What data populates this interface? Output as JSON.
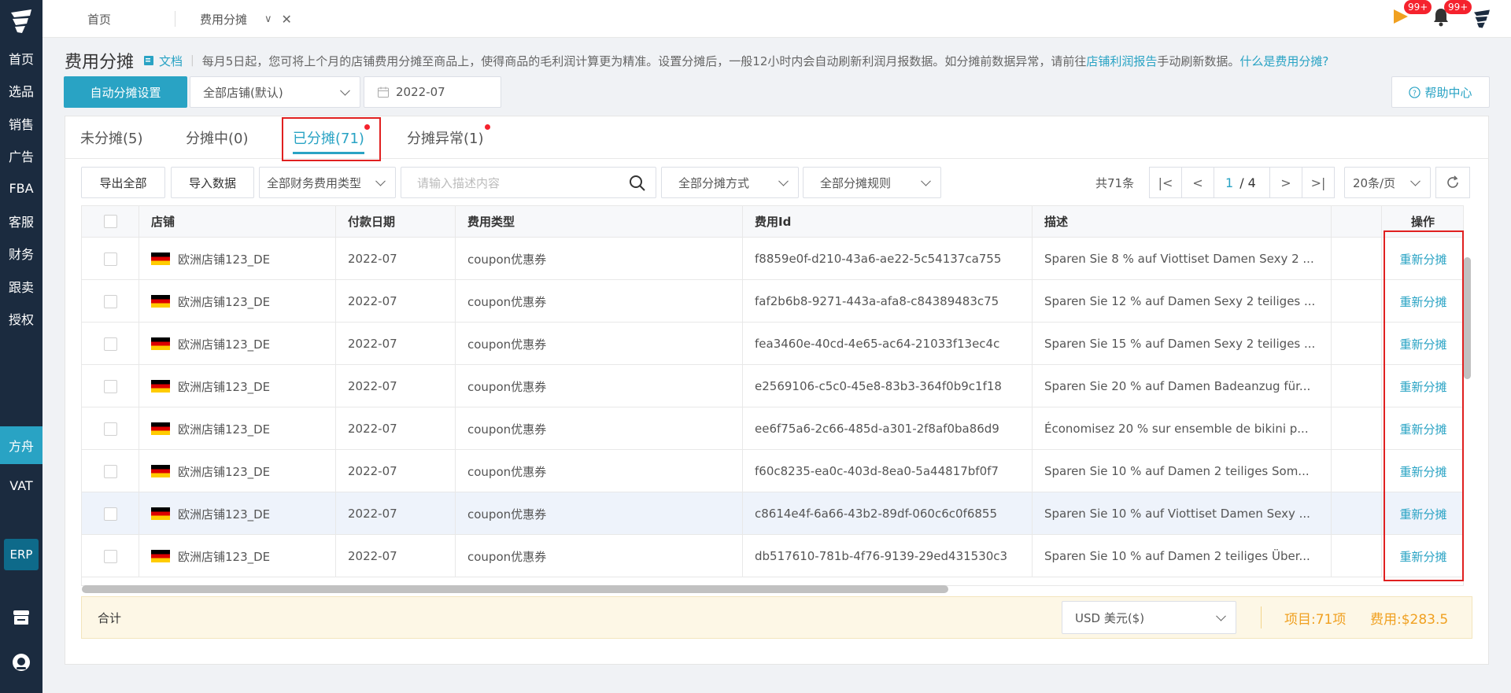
{
  "sidebar": {
    "items": [
      {
        "label": "首页"
      },
      {
        "label": "选品"
      },
      {
        "label": "销售"
      },
      {
        "label": "广告"
      },
      {
        "label": "FBA"
      },
      {
        "label": "客服"
      },
      {
        "label": "财务"
      },
      {
        "label": "跟卖"
      },
      {
        "label": "授权"
      },
      {
        "label": "方舟"
      },
      {
        "label": "VAT"
      }
    ],
    "erp_label": "ERP",
    "active_item": "方舟",
    "bottom_icons": [
      "store-icon",
      "support-icon"
    ]
  },
  "topbar": {
    "tabs": [
      {
        "label": "首页"
      },
      {
        "label": "费用分摊"
      }
    ],
    "badges": [
      {
        "icon": "flag-icon",
        "count": "99+"
      },
      {
        "icon": "bell-icon",
        "count": "99+"
      }
    ]
  },
  "header": {
    "title": "费用分摊",
    "doc_link": "文档",
    "notice_prefix": "每月5日起，您可将上个月的店铺费用分摊至商品上，使得商品的毛利润计算更为精准。设置分摊后，一般12小时内会自动刷新利润月报数据。如分摊前数据异常，请前往",
    "notice_link": "店铺利润报告",
    "notice_suffix": "手动刷新数据。",
    "notice_help_link": "什么是费用分摊?"
  },
  "controls": {
    "auto_button": "自动分摊设置",
    "store_select": "全部店铺(默认)",
    "month": "2022-07",
    "help_center": "帮助中心"
  },
  "status_tabs": [
    {
      "label": "未分摊(5)",
      "dot": false
    },
    {
      "label": "分摊中(0)",
      "dot": false
    },
    {
      "label": "已分摊(71)",
      "dot": true
    },
    {
      "label": "分摊异常(1)",
      "dot": true
    }
  ],
  "toolbar": {
    "export_all": "导出全部",
    "import_data": "导入数据",
    "expense_type_select": "全部财务费用类型",
    "search_placeholder": "请输入描述内容",
    "method_select": "全部分摊方式",
    "rule_select": "全部分摊规则",
    "total": "共71条",
    "current_page": "1",
    "total_pages": "/ 4",
    "page_size": "20条/页"
  },
  "table": {
    "columns": [
      "店铺",
      "付款日期",
      "费用类型",
      "费用Id",
      "描述",
      "操作"
    ],
    "rows": [
      {
        "store": "欧洲店铺123_DE",
        "date": "2022-07",
        "type": "coupon优惠券",
        "id": "f8859e0f-d210-43a6-ae22-5c54137ca755",
        "desc": "Sparen Sie 8 % auf Viottiset Damen Sexy 2 ...",
        "action": "重新分摊"
      },
      {
        "store": "欧洲店铺123_DE",
        "date": "2022-07",
        "type": "coupon优惠券",
        "id": "faf2b6b8-9271-443a-afa8-c84389483c75",
        "desc": "Sparen Sie 12 % auf Damen Sexy 2 teiliges ...",
        "action": "重新分摊"
      },
      {
        "store": "欧洲店铺123_DE",
        "date": "2022-07",
        "type": "coupon优惠券",
        "id": "fea3460e-40cd-4e65-ac64-21033f13ec4c",
        "desc": "Sparen Sie 15 % auf Damen Sexy 2 teiliges ...",
        "action": "重新分摊"
      },
      {
        "store": "欧洲店铺123_DE",
        "date": "2022-07",
        "type": "coupon优惠券",
        "id": "e2569106-c5c0-45e8-83b3-364f0b9c1f18",
        "desc": "Sparen Sie 20 % auf Damen Badeanzug für...",
        "action": "重新分摊"
      },
      {
        "store": "欧洲店铺123_DE",
        "date": "2022-07",
        "type": "coupon优惠券",
        "id": "ee6f75a6-2c66-485d-a301-2f8af0ba86d9",
        "desc": "Économisez 20 % sur ensemble de bikini p...",
        "action": "重新分摊"
      },
      {
        "store": "欧洲店铺123_DE",
        "date": "2022-07",
        "type": "coupon优惠券",
        "id": "f60c8235-ea0c-403d-8ea0-5a44817bf0f7",
        "desc": "Sparen Sie 10 % auf Damen 2 teiliges Som...",
        "action": "重新分摊"
      },
      {
        "store": "欧洲店铺123_DE",
        "date": "2022-07",
        "type": "coupon优惠券",
        "id": "c8614e4f-6a66-43b2-89df-060c6c0f6855",
        "desc": "Sparen Sie 10 % auf Viottiset Damen Sexy ...",
        "action": "重新分摊"
      },
      {
        "store": "欧洲店铺123_DE",
        "date": "2022-07",
        "type": "coupon优惠券",
        "id": "db517610-781b-4f76-9139-29ed431530c3",
        "desc": "Sparen Sie 10 % auf Damen 2 teiliges Über...",
        "action": "重新分摊"
      }
    ]
  },
  "summary": {
    "label": "合计",
    "currency": "USD  美元($)",
    "items_count": "项目:71项",
    "cost": "费用:$283.5"
  },
  "colors": {
    "accent": "#29a3c4",
    "sidebar_bg": "#1b2b3f",
    "summary_orange": "#f0a020",
    "highlight_red": "#e02020"
  }
}
